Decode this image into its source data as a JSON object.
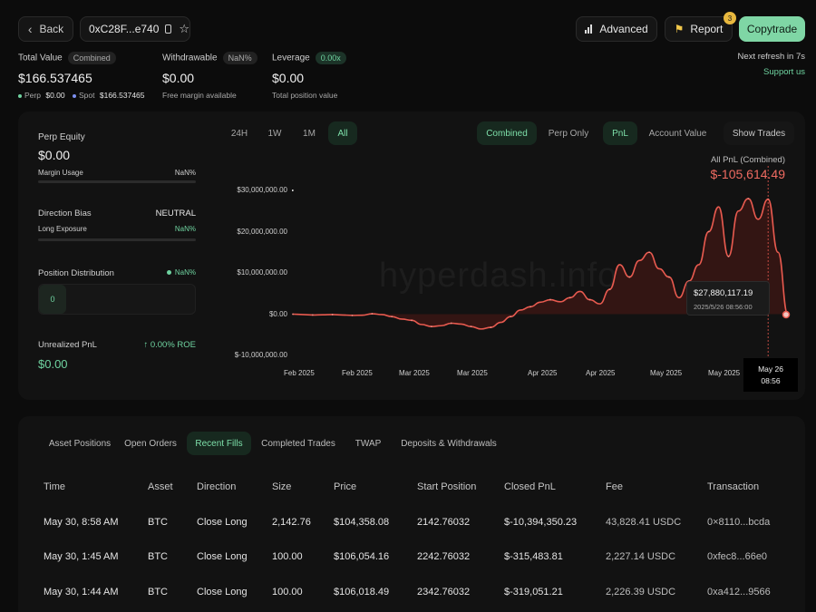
{
  "header": {
    "back_label": "Back",
    "address": "0xC28F...e740",
    "advanced_label": "Advanced",
    "report_label": "Report",
    "report_badge": "3",
    "copytrade_label": "Copytrade",
    "refresh_text": "Next refresh in 7s",
    "support_label": "Support us"
  },
  "stats": {
    "total_value_label": "Total Value",
    "total_value_chip": "Combined",
    "total_value": "$166.537465",
    "perp_label": "Perp",
    "perp_value": "$0.00",
    "spot_label": "Spot",
    "spot_value": "$166.537465",
    "withdrawable_label": "Withdrawable",
    "withdrawable_chip": "NaN%",
    "withdrawable_value": "$0.00",
    "withdrawable_sub": "Free margin available",
    "leverage_label": "Leverage",
    "leverage_chip": "0.00x",
    "leverage_value": "$0.00",
    "leverage_sub": "Total position value"
  },
  "left_panel": {
    "perp_equity_label": "Perp Equity",
    "perp_equity_value": "$0.00",
    "margin_usage_label": "Margin Usage",
    "margin_usage_value": "NaN%",
    "direction_bias_label": "Direction Bias",
    "direction_bias_value": "NEUTRAL",
    "long_exposure_label": "Long Exposure",
    "long_exposure_value": "NaN%",
    "position_distribution_label": "Position Distribution",
    "position_distribution_value": "NaN%",
    "position_count": "0",
    "unrealized_pnl_label": "Unrealized PnL",
    "unrealized_roe": "↑ 0.00% ROE",
    "unrealized_pnl_value": "$0.00"
  },
  "chart_controls": {
    "ranges": [
      "24H",
      "1W",
      "1M",
      "All"
    ],
    "active_range": "All",
    "modes": [
      "Combined",
      "Perp Only"
    ],
    "active_mode": "Combined",
    "metrics": [
      "PnL",
      "Account Value"
    ],
    "active_metric": "PnL",
    "show_trades_label": "Show Trades"
  },
  "chart_data": {
    "type": "area",
    "title": "All PnL (Combined)",
    "headline_value": "$-105,614.49",
    "yticks": [
      "$30,000,000.00",
      "$20,000,000.00",
      "$10,000,000.00",
      "$0.00",
      "$-10,000,000.00"
    ],
    "ylim": [
      -10000000,
      30000000
    ],
    "xticks": [
      "Feb 2025",
      "Feb 2025",
      "Mar 2025",
      "Mar 2025",
      "Apr 2025",
      "Apr 2025",
      "May 2025",
      "May 2025"
    ],
    "x": [
      0,
      2,
      4,
      6,
      8,
      10,
      12,
      14,
      16,
      18,
      20,
      22,
      24,
      26,
      28,
      30,
      32,
      34,
      36,
      38,
      40,
      42,
      44,
      46,
      48,
      50,
      52,
      54,
      56,
      58,
      60,
      62,
      64,
      66,
      68,
      70,
      72,
      74,
      76,
      78,
      80,
      82,
      84,
      86,
      88,
      90,
      92,
      94,
      96,
      98,
      100
    ],
    "values": [
      0,
      -100000,
      -200000,
      -150000,
      -100000,
      -200000,
      -300000,
      -250000,
      100000,
      -100000,
      -600000,
      -1200000,
      -1500000,
      -2500000,
      -3000000,
      -2800000,
      -2200000,
      -2400000,
      -3000000,
      -3600000,
      -3200000,
      -2000000,
      -600000,
      1000000,
      1800000,
      2900000,
      3500000,
      3000000,
      4000000,
      5500000,
      3500000,
      2500000,
      6000000,
      12000000,
      9000000,
      13000000,
      15000000,
      11000000,
      9000000,
      4000000,
      8000000,
      12000000,
      20000000,
      26000000,
      14000000,
      25000000,
      28000000,
      23000000,
      27880117,
      15000000,
      -105614
    ],
    "tooltip_value": "$27,880,117.19",
    "tooltip_date": "2025/5/26 08:56:00",
    "crosshair_date": "May 26",
    "crosshair_time": "08:56",
    "watermark": "hyperdash.info",
    "colors": {
      "line": "#e85a4f",
      "fill": "#3a1614"
    }
  },
  "table": {
    "tabs": [
      "Asset Positions",
      "Open Orders",
      "Recent Fills",
      "Completed Trades",
      "TWAP",
      "Deposits & Withdrawals"
    ],
    "active_tab": "Recent Fills",
    "columns": [
      "Time",
      "Asset",
      "Direction",
      "Size",
      "Price",
      "Start Position",
      "Closed PnL",
      "Fee",
      "Transaction"
    ],
    "rows": [
      [
        "May 30, 8:58 AM",
        "BTC",
        "Close Long",
        "2,142.76",
        "$104,358.08",
        "2142.76032",
        "$-10,394,350.23",
        "43,828.41 USDC",
        "0×8110...bcda"
      ],
      [
        "May 30, 1:45 AM",
        "BTC",
        "Close Long",
        "100.00",
        "$106,054.16",
        "2242.76032",
        "$-315,483.81",
        "2,227.14 USDC",
        "0xfec8...66e0"
      ],
      [
        "May 30, 1:44 AM",
        "BTC",
        "Close Long",
        "100.00",
        "$106,018.49",
        "2342.76032",
        "$-319,051.21",
        "2,226.39 USDC",
        "0xa412...9566"
      ]
    ]
  }
}
